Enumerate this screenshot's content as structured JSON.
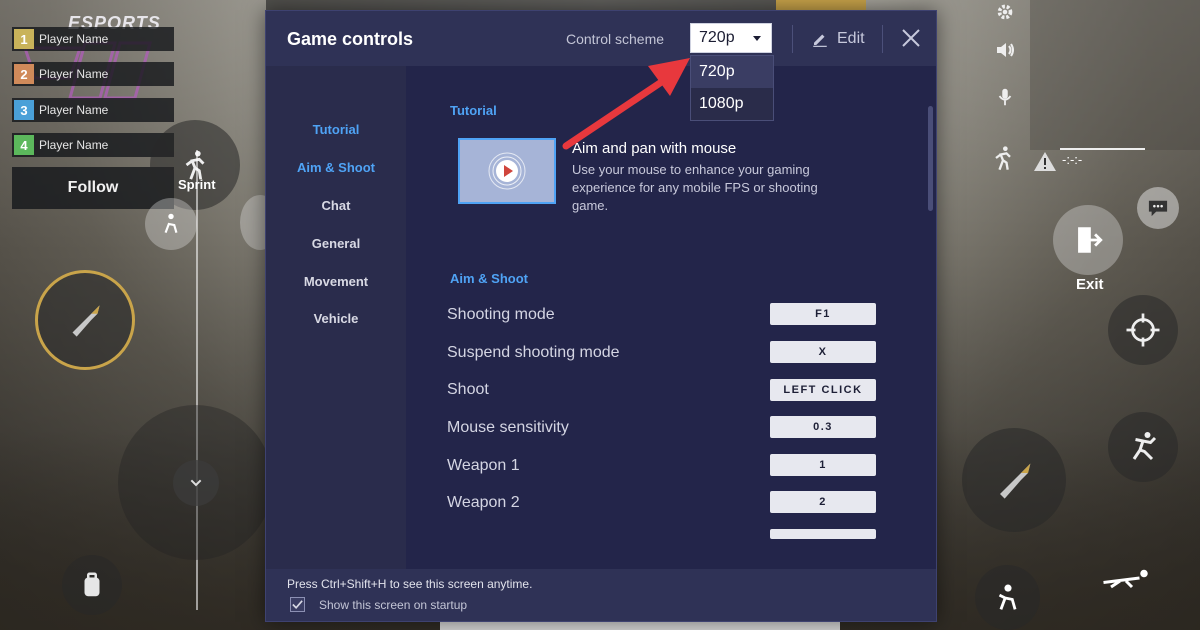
{
  "game": {
    "brand": "ESPORTS",
    "players": [
      {
        "num": "1",
        "name": "Player Name",
        "color": "#c9b35a"
      },
      {
        "num": "2",
        "name": "Player Name",
        "color": "#d08a5a"
      },
      {
        "num": "3",
        "name": "Player Name",
        "color": "#4aa0d8"
      },
      {
        "num": "4",
        "name": "Player Name",
        "color": "#5cb85c"
      }
    ],
    "follow_label": "Follow",
    "sprint_label": "Sprint",
    "exit_label": "Exit",
    "status_text": "-:-:-"
  },
  "dialog": {
    "title": "Game controls",
    "control_scheme_label": "Control scheme",
    "selected_scheme": "720p",
    "scheme_options": [
      "720p",
      "1080p"
    ],
    "edit_label": "Edit"
  },
  "sidebar": {
    "items": [
      "Tutorial",
      "Aim & Shoot",
      "Chat",
      "General",
      "Movement",
      "Vehicle"
    ],
    "active": "Aim & Shoot"
  },
  "content": {
    "tutorial_section": "Tutorial",
    "tutorial_title": "Aim and pan with mouse",
    "tutorial_desc": "Use your mouse to enhance your gaming experience for any mobile FPS or shooting game.",
    "aim_section": "Aim & Shoot",
    "rows": [
      {
        "label": "Shooting mode",
        "key": "F1"
      },
      {
        "label": "Suspend shooting mode",
        "key": "X"
      },
      {
        "label": "Shoot",
        "key": "LEFT CLICK"
      },
      {
        "label": "Mouse sensitivity",
        "key": "0.3"
      },
      {
        "label": "Weapon 1",
        "key": "1"
      },
      {
        "label": "Weapon 2",
        "key": "2"
      }
    ]
  },
  "footer": {
    "hint": "Press Ctrl+Shift+H to see this screen anytime.",
    "startup_label": "Show this screen on startup",
    "startup_checked": true
  },
  "colors": {
    "accent": "#4fa3f5",
    "dialog_bg": "#262846",
    "arrow": "#e8383d"
  }
}
